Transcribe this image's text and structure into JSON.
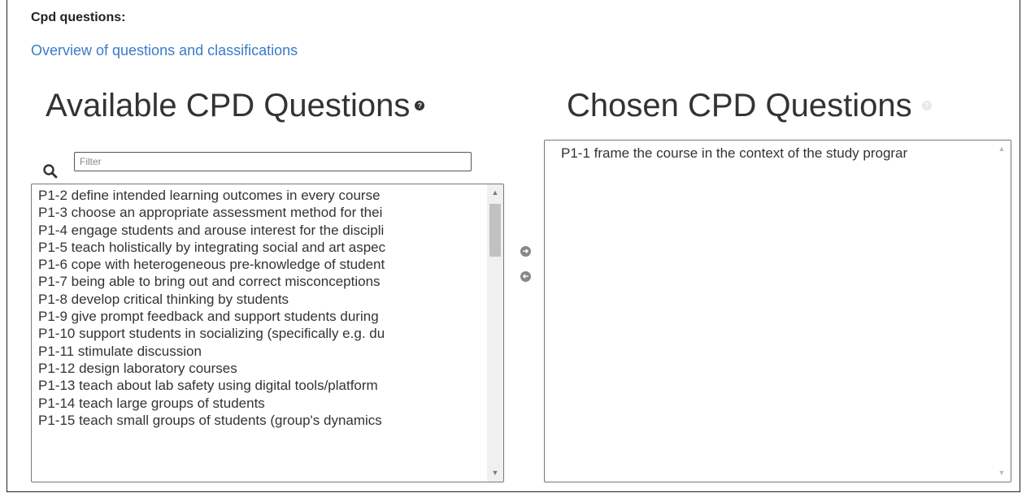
{
  "section": {
    "label": "Cpd questions:",
    "overview_link": "Overview of questions and classifications"
  },
  "available": {
    "title": "Available CPD Questions",
    "help": "?",
    "filter_placeholder": "Filter",
    "items": [
      "P1-2 define intended learning outcomes in every course",
      "P1-3 choose an appropriate assessment method for thei",
      "P1-4 engage students and arouse interest for the discipli",
      "P1-5 teach holistically by integrating social and art aspec",
      "P1-6 cope with heterogeneous pre-knowledge of student",
      "P1-7 being able to bring out and correct misconceptions",
      "P1-8 develop critical thinking by students",
      "P1-9 give prompt feedback and support students during",
      "P1-10 support students in socializing (specifically e.g. du",
      "P1-11 stimulate discussion",
      "P1-12 design laboratory courses",
      "P1-13 teach about lab safety using digital tools/platform",
      "P1-14 teach large groups of students",
      "P1-15 teach small groups of students (group's dynamics"
    ]
  },
  "chosen": {
    "title": "Chosen CPD Questions",
    "help": "?",
    "items": [
      "P1-1 frame the course in the context of the study prograr"
    ]
  },
  "icons": {
    "search": "search-icon",
    "move_right": "arrow-right-circle-icon",
    "move_left": "arrow-left-circle-icon",
    "help": "question-circle-icon"
  },
  "colors": {
    "link": "#3a7bc8",
    "text": "#333333"
  }
}
